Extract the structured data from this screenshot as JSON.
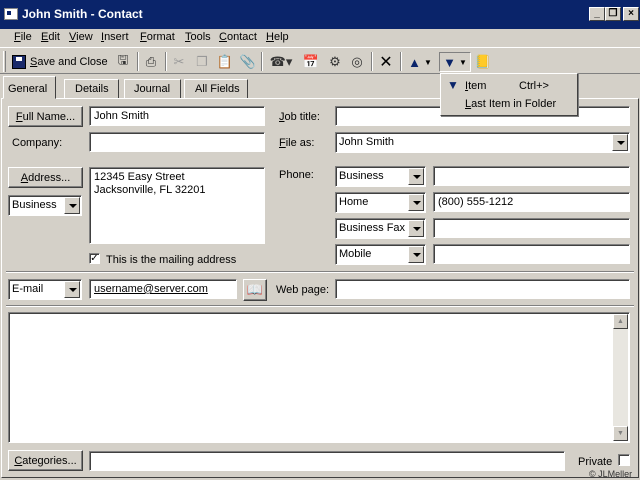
{
  "window": {
    "title": "John Smith - Contact",
    "copyright": "© JLMeller"
  },
  "menubar": {
    "items": [
      "File",
      "Edit",
      "View",
      "Insert",
      "Format",
      "Tools",
      "Contact",
      "Help"
    ]
  },
  "toolbar": {
    "save_close_label": "Save and Close"
  },
  "next_menu": {
    "items": [
      {
        "label": "Item",
        "shortcut": "Ctrl+>"
      },
      {
        "label": "Last Item in Folder",
        "shortcut": ""
      }
    ]
  },
  "tabs": [
    "General",
    "Details",
    "Journal",
    "All Fields"
  ],
  "form": {
    "full_name_button": "Full Name...",
    "full_name_value": "John Smith",
    "job_title_label": "Job title:",
    "job_title_value": "",
    "company_label": "Company:",
    "company_value": "",
    "file_as_label": "File as:",
    "file_as_value": "John Smith",
    "address_button": "Address...",
    "address_line1": "12345 Easy Street",
    "address_line2": "Jacksonville, FL  32201",
    "address_type": "Business",
    "mailing_address_label": "This is the mailing address",
    "mailing_address_checked": true,
    "phone_label": "Phone:",
    "phones": [
      {
        "type": "Business",
        "value": ""
      },
      {
        "type": "Home",
        "value": "(800) 555-1212"
      },
      {
        "type": "Business Fax",
        "value": ""
      },
      {
        "type": "Mobile",
        "value": ""
      }
    ],
    "email_type": "E-mail",
    "email_value": "username@server.com",
    "web_page_label": "Web page:",
    "web_page_value": "",
    "notes_value": "",
    "categories_button": "Categories...",
    "categories_value": "",
    "private_label": "Private",
    "private_checked": false
  }
}
